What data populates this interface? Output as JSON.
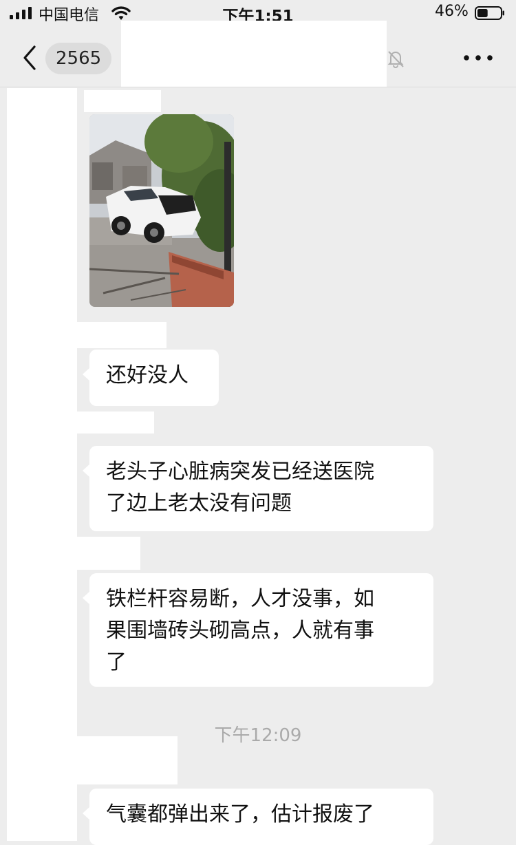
{
  "status_bar": {
    "carrier": "中国电信",
    "time": "下午1:51",
    "battery_percent": "46%",
    "battery_level": 0.46
  },
  "nav": {
    "unread_count": "2565",
    "mute_icon": "bell-slash-icon",
    "more_icon": "ellipsis-icon",
    "back_icon": "chevron-left-icon"
  },
  "messages": [
    {
      "type": "image",
      "description_icon": "photo-thumbnail"
    },
    {
      "type": "text",
      "lines": [
        "还好没人"
      ]
    },
    {
      "type": "text",
      "lines": [
        "老头子心脏病突发已经送医院",
        "了边上老太没有问题"
      ]
    },
    {
      "type": "text",
      "lines": [
        "铁栏杆容易断，人才没事，如",
        "果围墙砖头砌高点，人就有事",
        "了"
      ]
    },
    {
      "type": "text",
      "lines": [
        "气囊都弹出来了，估计报废了"
      ]
    }
  ],
  "timestamp": "下午12:09",
  "colors": {
    "background": "#ededed",
    "bubble": "#ffffff",
    "timestamp": "#aaaaaa"
  }
}
